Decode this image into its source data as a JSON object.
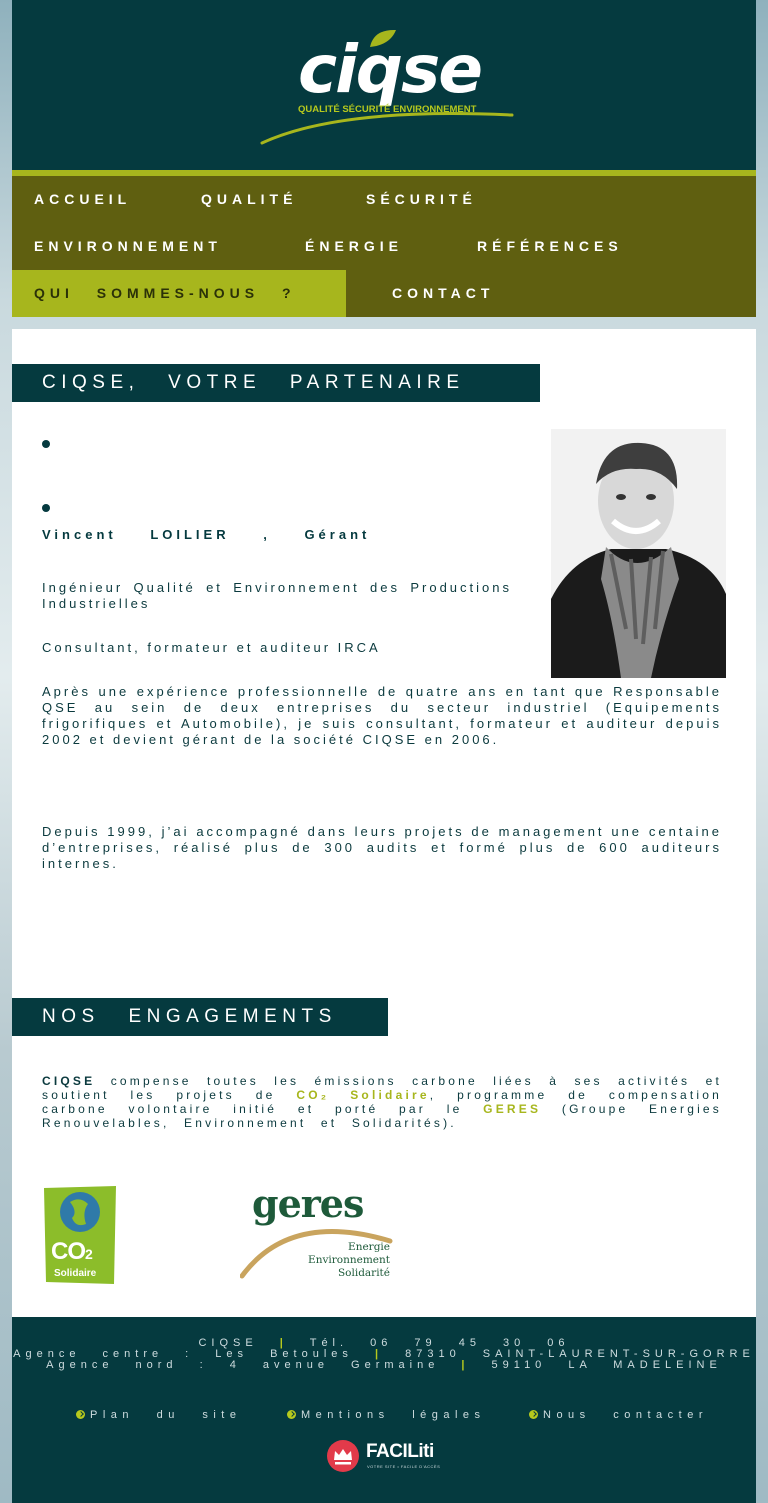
{
  "header": {
    "logo_text": "ciqse",
    "logo_tagline": "QUALITÉ SÉCURITÉ ENVIRONNEMENT"
  },
  "nav": {
    "items": [
      {
        "label": "ACCUEIL"
      },
      {
        "label": "QUALITÉ"
      },
      {
        "label": "SÉCURITÉ"
      },
      {
        "label": "ENVIRONNEMENT"
      },
      {
        "label": "ÉNERGIE"
      },
      {
        "label": "RÉFÉRENCES"
      },
      {
        "label": "QUI SOMMES-NOUS ?"
      },
      {
        "label": "CONTACT"
      }
    ],
    "active": "QUI SOMMES-NOUS ?"
  },
  "partner": {
    "title": "CIQSE, VOTRE PARTENAIRE",
    "name": "Vincent LOILIER , Gérant",
    "paragraphs": [
      "Ingénieur Qualité et Environnement des Productions Industrielles",
      "Consultant, formateur et auditeur IRCA",
      "Après une expérience professionnelle de quatre ans en tant que Responsable QSE au sein de deux entreprises du secteur industriel (Equipements frigorifiques et Automobile), je suis consultant, formateur et auditeur depuis 2002 et devient gérant de la société CIQSE en 2006.",
      "Depuis 1999, j’ai accompagné dans leurs projets de management une centaine d’entreprises, réalisé plus de 300 audits et formé plus de 600 auditeurs internes."
    ]
  },
  "engagements": {
    "title": "NOS ENGAGEMENTS",
    "brand": "CIQSE",
    "text_1": " compense toutes les émissions carbone liées à ses activités et soutient les projets de ",
    "program": "CO₂ Solidaire",
    "text_2": ", programme de compensation carbone volontaire initié et porté par le ",
    "org": "GERES",
    "text_3": " (Groupe Energies Renouvelables, Environnement et Solidarités).",
    "co2_logo": {
      "main": "CO",
      "sub": "2",
      "label": "Solidaire"
    },
    "geres_logo": {
      "word": "geres",
      "lines": [
        "Energie",
        "Environnement",
        "Solidarité"
      ]
    }
  },
  "footer": {
    "line1": {
      "a": "CIQSE",
      "sep": "|",
      "b": "Tél. 06 79 45 30 06"
    },
    "line2": {
      "a": "Agence centre : Les Betoules",
      "sep": "|",
      "b": "87310 SAINT-LAURENT-SUR-GORRE"
    },
    "line3": {
      "a": "Agence nord : 4 avenue Germaine",
      "sep": "|",
      "b": "59110 LA MADELEINE"
    },
    "links": [
      {
        "label": "Plan du site"
      },
      {
        "label": "Mentions légales"
      },
      {
        "label": "Nous contacter"
      }
    ],
    "faciliti": {
      "word": "FACILiti",
      "sub": "VOTRE SITE • FACILE D'ACCÈS"
    }
  },
  "colors": {
    "brand_dark": "#053a3f",
    "accent_green": "#a7b61d",
    "nav_olive": "#5f5f10"
  }
}
